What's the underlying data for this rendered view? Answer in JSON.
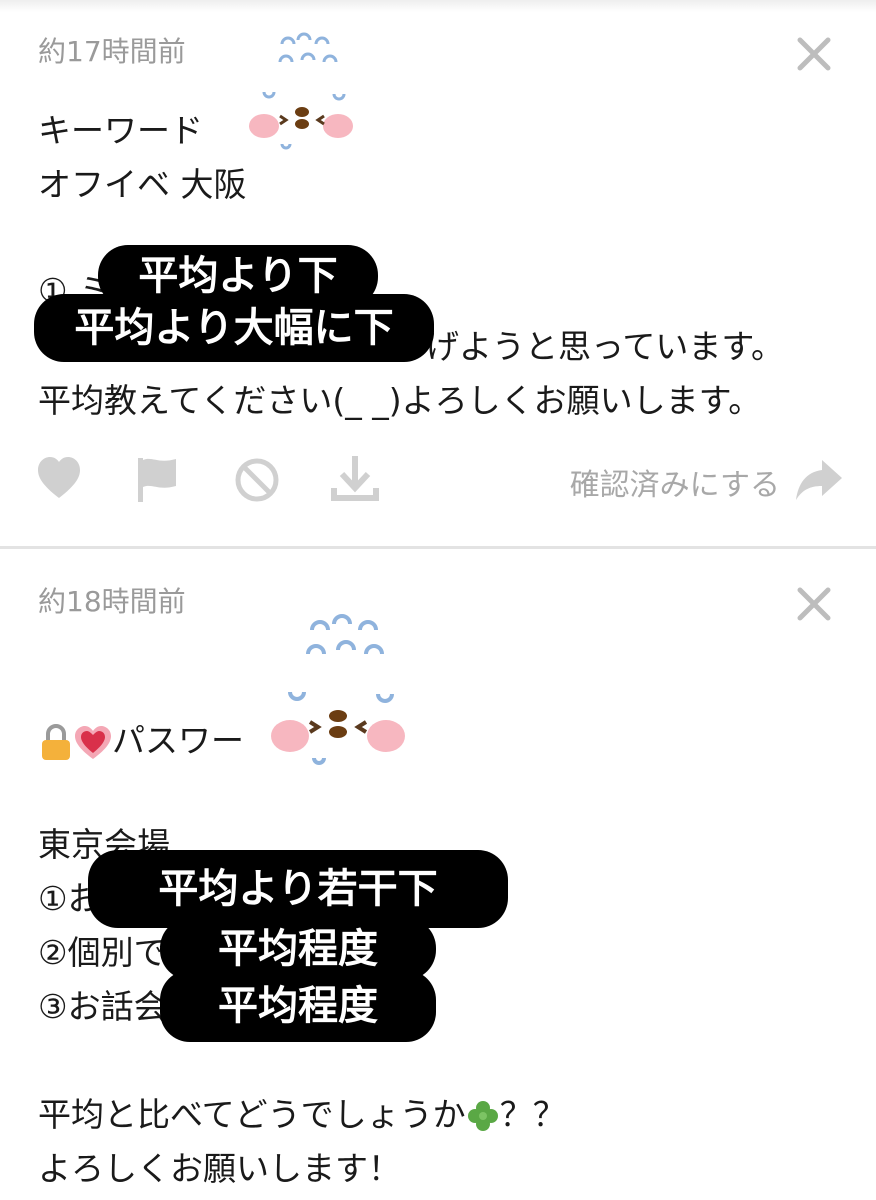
{
  "posts": [
    {
      "time": "約17時間前",
      "lines": [
        "キーワード",
        "オフイベ 大阪",
        "",
        "① ミ",
        "げようと思っています。",
        "平均教えてください(_ _)よろしくお願いします。"
      ],
      "overlays": [
        "平均より下",
        "平均より大幅に下"
      ],
      "actions": {
        "confirm_label": "確認済みにする"
      }
    },
    {
      "time": "約18時間前",
      "lines": [
        "パスワー",
        "東京会場",
        "①お",
        "②個別で",
        "③お話会",
        "平均と比べてどうでしょうか",
        "？？",
        "よろしくお願いします！"
      ],
      "overlays": [
        "平均より若干下",
        "平均程度",
        "平均程度"
      ]
    }
  ],
  "icons": {
    "close": "close-icon",
    "like": "heart-icon",
    "flag": "flag-icon",
    "block": "block-icon",
    "download": "download-icon",
    "share": "share-arrow-icon",
    "lock": "lock-icon",
    "heart": "heart-emoji-icon",
    "clover": "clover-icon",
    "sticker": "sweating-chick-sticker"
  },
  "colors": {
    "overlay_bg": "#000000",
    "timestamp": "#9a9a9a",
    "icon_gray": "#d0d0d0",
    "divider": "#e3e3e3"
  }
}
